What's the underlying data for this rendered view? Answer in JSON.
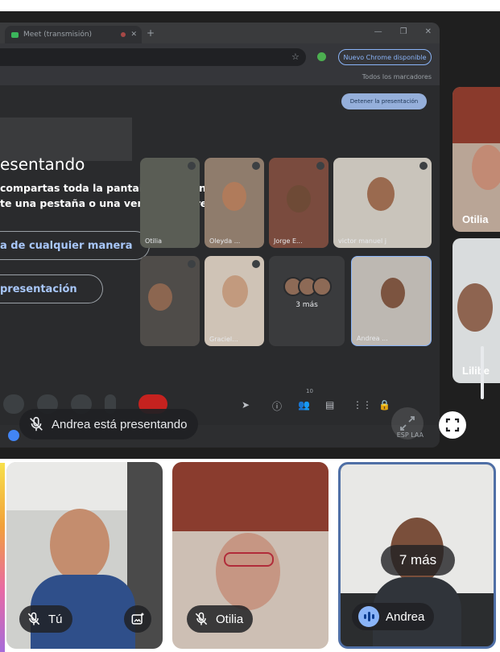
{
  "shared_screen": {
    "tab_title": "Meet (transmisión)",
    "update_label": "Nuevo Chrome disponible",
    "bookmarks_label": "Todos los marcadores",
    "stop_label": "Detener la presentación",
    "heading": "esentando",
    "description": "compartas toda la pantalla o ventana del te una pestaña o una ventana diferente.",
    "button_any_way": "a de cualquier manera",
    "button_presentation": "presentación",
    "tiles": [
      {
        "name": "Otilia"
      },
      {
        "name": "Oleyda ..."
      },
      {
        "name": "Jorge E..."
      },
      {
        "name": "victor manuel j"
      },
      {
        "name": ""
      },
      {
        "name": "Graciel..."
      },
      {
        "name": "3 más"
      },
      {
        "name": "Andrea ..."
      }
    ],
    "tray_status": "ESP LAA",
    "participants_count": "10"
  },
  "presenting_label": "Andrea está presentando",
  "right_tiles": [
    {
      "name": "Otilia"
    },
    {
      "name": "Lilibe"
    }
  ],
  "bottom_tiles": [
    {
      "name": "Tú"
    },
    {
      "name": "Otilia"
    },
    {
      "name": "Andrea",
      "overlay": "7 más"
    }
  ],
  "colors": {
    "speaking_border": "#4f6fa6",
    "accent": "#8ab4f8"
  }
}
